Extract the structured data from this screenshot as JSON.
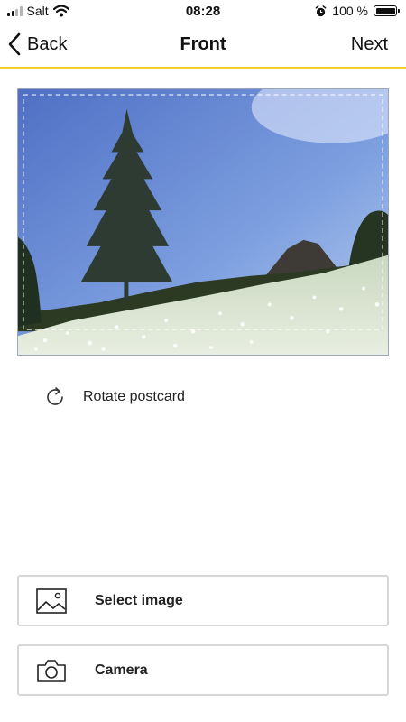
{
  "status_bar": {
    "carrier": "Salt",
    "time": "08:28",
    "battery": "100 %",
    "battery_level": 1.0
  },
  "nav": {
    "back_label": "Back",
    "title": "Front",
    "next_label": "Next",
    "accent_color": "#f2cc2b"
  },
  "postcard": {
    "image_description": "mountain meadow with white flowers, tall conifer and rocky peak under blue sky",
    "icon": "photo"
  },
  "rotate": {
    "label": "Rotate postcard",
    "icon": "rotate-icon"
  },
  "actions": {
    "select_image_label": "Select image",
    "camera_label": "Camera"
  }
}
